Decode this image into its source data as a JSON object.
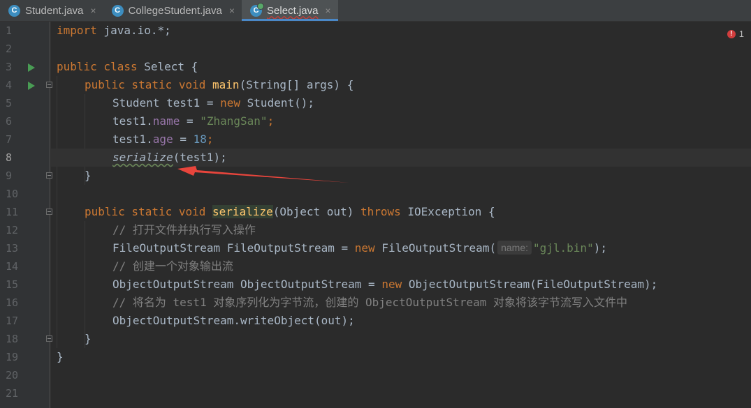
{
  "tabs": [
    {
      "label": "Student.java",
      "icon": "java-class-icon",
      "active": false
    },
    {
      "label": "CollegeStudent.java",
      "icon": "java-class-icon",
      "active": false
    },
    {
      "label": "Select.java",
      "icon": "java-class-icon",
      "active": true
    }
  ],
  "tab_close_glyph": "×",
  "tab_icon_letter": "C",
  "error_indicator": {
    "count": "1",
    "glyph": "!"
  },
  "colors": {
    "background": "#2b2b2b",
    "keyword": "#cc7832",
    "string": "#6a8759",
    "number": "#6897bb",
    "field": "#9876aa",
    "method": "#ffc66d",
    "comment": "#808080",
    "annotation_arrow": "#e8453c"
  },
  "gutter": {
    "line_numbers": [
      "1",
      "2",
      "3",
      "4",
      "5",
      "6",
      "7",
      "8",
      "9",
      "10",
      "11",
      "12",
      "13",
      "14",
      "15",
      "16",
      "17",
      "18",
      "19",
      "20",
      "21"
    ],
    "current_line": "8"
  },
  "code": {
    "l1": {
      "t1": "import",
      "t2": " java.io.*;"
    },
    "l3": {
      "t1": "public class",
      "t2": " Select {"
    },
    "l4": {
      "t1": "public static void",
      "t2": "main",
      "t3": "(String[] args) {"
    },
    "l5": {
      "t1": "Student test1 = ",
      "t2": "new",
      "t3": " Student();"
    },
    "l6": {
      "t1": "test1.",
      "t2": "name",
      "t3": " = ",
      "t4": "\"ZhangSan\"",
      "t5": ";"
    },
    "l7": {
      "t1": "test1.",
      "t2": "age",
      "t3": " = ",
      "t4": "18",
      "t5": ";"
    },
    "l8": {
      "t1": "serialize",
      "t2": "(test1);"
    },
    "l9": {
      "t1": "}"
    },
    "l11": {
      "t1": "public static void",
      "t2": "serialize",
      "t3": "(Object out) ",
      "t4": "throws",
      "t5": " IOException {"
    },
    "l12": {
      "t1": "// 打开文件并执行写入操作"
    },
    "l13": {
      "t1": "FileOutputStream FileOutputStream = ",
      "t2": "new",
      "t3": " FileOutputStream(",
      "hint": "name:",
      "t4": "\"gjl.bin\"",
      "t5": ");"
    },
    "l14": {
      "t1": "// 创建一个对象输出流"
    },
    "l15": {
      "t1": "ObjectOutputStream ObjectOutputStream = ",
      "t2": "new",
      "t3": " ObjectOutputStream(FileOutputStream);"
    },
    "l16": {
      "t1": "// 将名为 test1 对象序列化为字节流，创建的 ObjectOutputStream 对象将该字节流写入文件中"
    },
    "l17": {
      "t1": "ObjectOutputStream.writeObject(out);"
    },
    "l18": {
      "t1": "}"
    },
    "l19": {
      "t1": "}"
    }
  }
}
